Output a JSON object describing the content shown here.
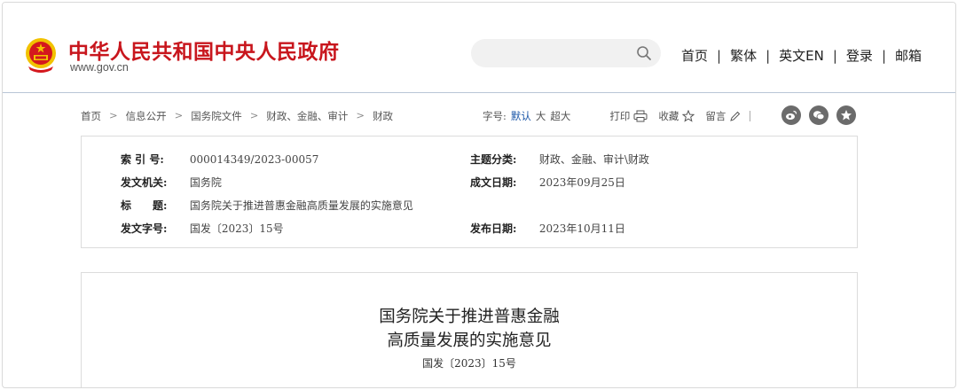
{
  "header": {
    "site_title": "中华人民共和国中央人民政府",
    "site_domain": "www.gov.cn",
    "search": {
      "placeholder": "",
      "value": ""
    },
    "nav": [
      {
        "label": "首页"
      },
      {
        "label": "繁体"
      },
      {
        "label": "英文EN"
      },
      {
        "label": "登录"
      },
      {
        "label": "邮箱"
      }
    ],
    "separator": "|"
  },
  "breadcrumb": {
    "items": [
      "首页",
      "信息公开",
      "国务院文件",
      "财政、金融、审计",
      "财政"
    ],
    "arrow": ">"
  },
  "toolbar": {
    "font_size_label": "字号:",
    "font_sizes": [
      "默认",
      "大",
      "超大"
    ],
    "print_label": "打印",
    "favorite_label": "收藏",
    "comment_label": "留言",
    "share_icons": [
      "weibo-icon",
      "wechat-icon",
      "qzone-icon"
    ]
  },
  "info": {
    "index_no": {
      "label": "索 引 号:",
      "value": "000014349/2023-00057"
    },
    "topic": {
      "label": "主题分类:",
      "value": "财政、金融、审计\\财政"
    },
    "issuer": {
      "label": "发文机关:",
      "value": "国务院"
    },
    "written_date": {
      "label": "成文日期:",
      "value": "2023年09月25日"
    },
    "title": {
      "label": "标　　题:",
      "value": "国务院关于推进普惠金融高质量发展的实施意见"
    },
    "doc_no": {
      "label": "发文字号:",
      "value": "国发〔2023〕15号"
    },
    "publish_date": {
      "label": "发布日期:",
      "value": "2023年10月11日"
    }
  },
  "article": {
    "title_line1": "国务院关于推进普惠金融",
    "title_line2": "高质量发展的实施意见",
    "doc_no": "国发〔2023〕15号"
  },
  "colors": {
    "brand_red": "#c8161d",
    "emblem_gold": "#f2c200",
    "active_link": "#1a56a8",
    "header_border": "#b9c6d6"
  }
}
